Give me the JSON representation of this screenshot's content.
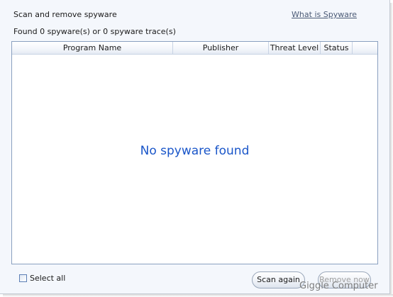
{
  "header": {
    "title": "Scan and remove spyware",
    "help_link": "What is Spyware"
  },
  "summary": "Found 0 spyware(s) or 0 spyware trace(s)",
  "table": {
    "columns": [
      "Program Name",
      "Publisher",
      "Threat Level",
      "Status",
      ""
    ],
    "rows": [],
    "empty_message": "No spyware found"
  },
  "footer": {
    "select_all_label": "Select all",
    "select_all_checked": false,
    "scan_again_label": "Scan again",
    "remove_now_label": "Remove now",
    "remove_now_enabled": false
  },
  "watermark": "Giggle Computer"
}
